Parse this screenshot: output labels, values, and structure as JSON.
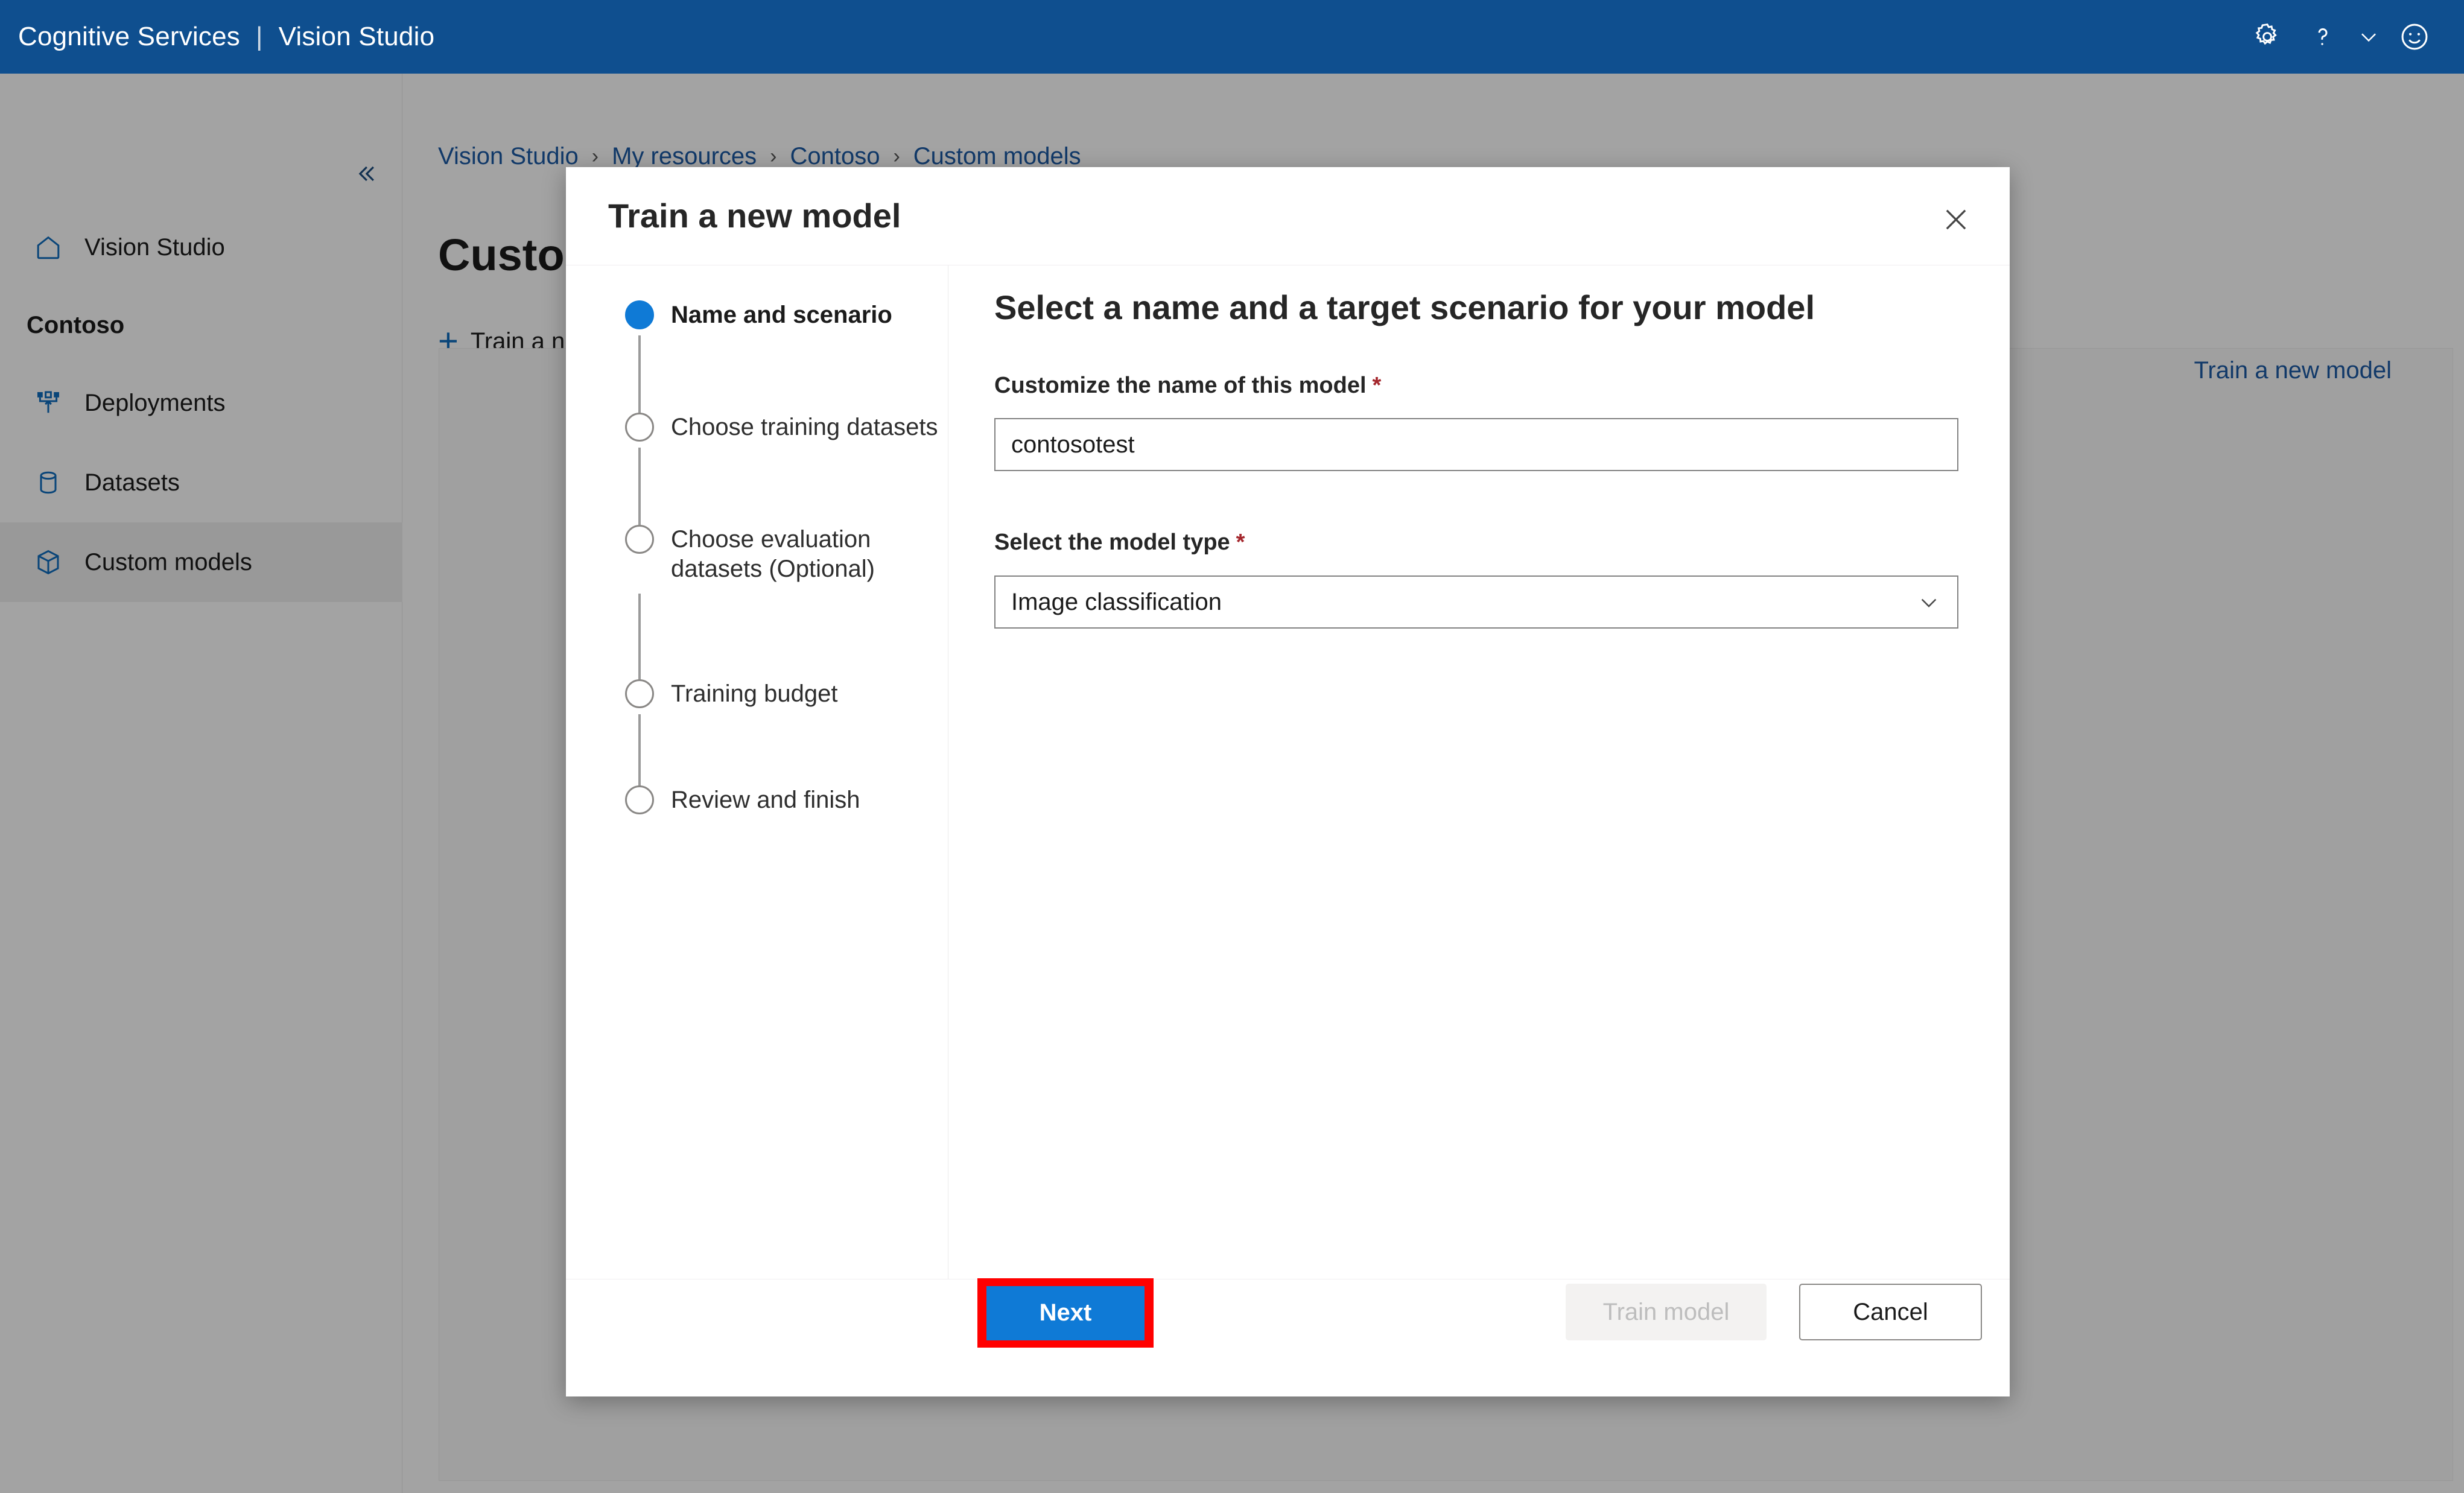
{
  "topbar": {
    "brand_primary": "Cognitive Services",
    "brand_separator": "|",
    "brand_secondary": "Vision Studio",
    "icons": [
      "gear-icon",
      "question-icon",
      "chevron-down-icon",
      "smiley-icon"
    ],
    "background_color": "#0f4f8f"
  },
  "sidebar": {
    "collapse_icon": "double-chevron-left-icon",
    "home_item": {
      "label": "Vision Studio",
      "icon": "home-icon"
    },
    "section_label": "Contoso",
    "items": [
      {
        "label": "Deployments",
        "icon": "deployments-icon",
        "selected": false
      },
      {
        "label": "Datasets",
        "icon": "database-icon",
        "selected": false
      },
      {
        "label": "Custom models",
        "icon": "box-icon",
        "selected": true
      }
    ]
  },
  "main": {
    "breadcrumb": [
      "Vision Studio",
      "My resources",
      "Contoso",
      "Custom models"
    ],
    "breadcrumb_separator": "›",
    "page_title": "Custom models",
    "command_add_icon": "plus-icon",
    "command_label": "Train a new model",
    "card_hint": "Train a new model"
  },
  "dialog": {
    "title": "Train a new model",
    "close_icon": "close-icon",
    "steps": [
      {
        "label": "Name and scenario",
        "active": true
      },
      {
        "label": "Choose training datasets",
        "active": false
      },
      {
        "label": "Choose evaluation datasets (Optional)",
        "active": false
      },
      {
        "label": "Training budget",
        "active": false
      },
      {
        "label": "Review and finish",
        "active": false
      }
    ],
    "panel": {
      "heading": "Select a name and a target scenario for your model",
      "name_label": "Customize the name of this model",
      "name_required_mark": "*",
      "name_value": "contosotest",
      "name_placeholder": "",
      "type_label": "Select the model type",
      "type_required_mark": "*",
      "type_value": "Image classification",
      "type_chevron_icon": "chevron-down-icon"
    },
    "footer": {
      "next_label": "Next",
      "train_label": "Train model",
      "cancel_label": "Cancel",
      "next_highlight_color": "#ff0000",
      "next_button_color": "#0f7ad6"
    }
  }
}
